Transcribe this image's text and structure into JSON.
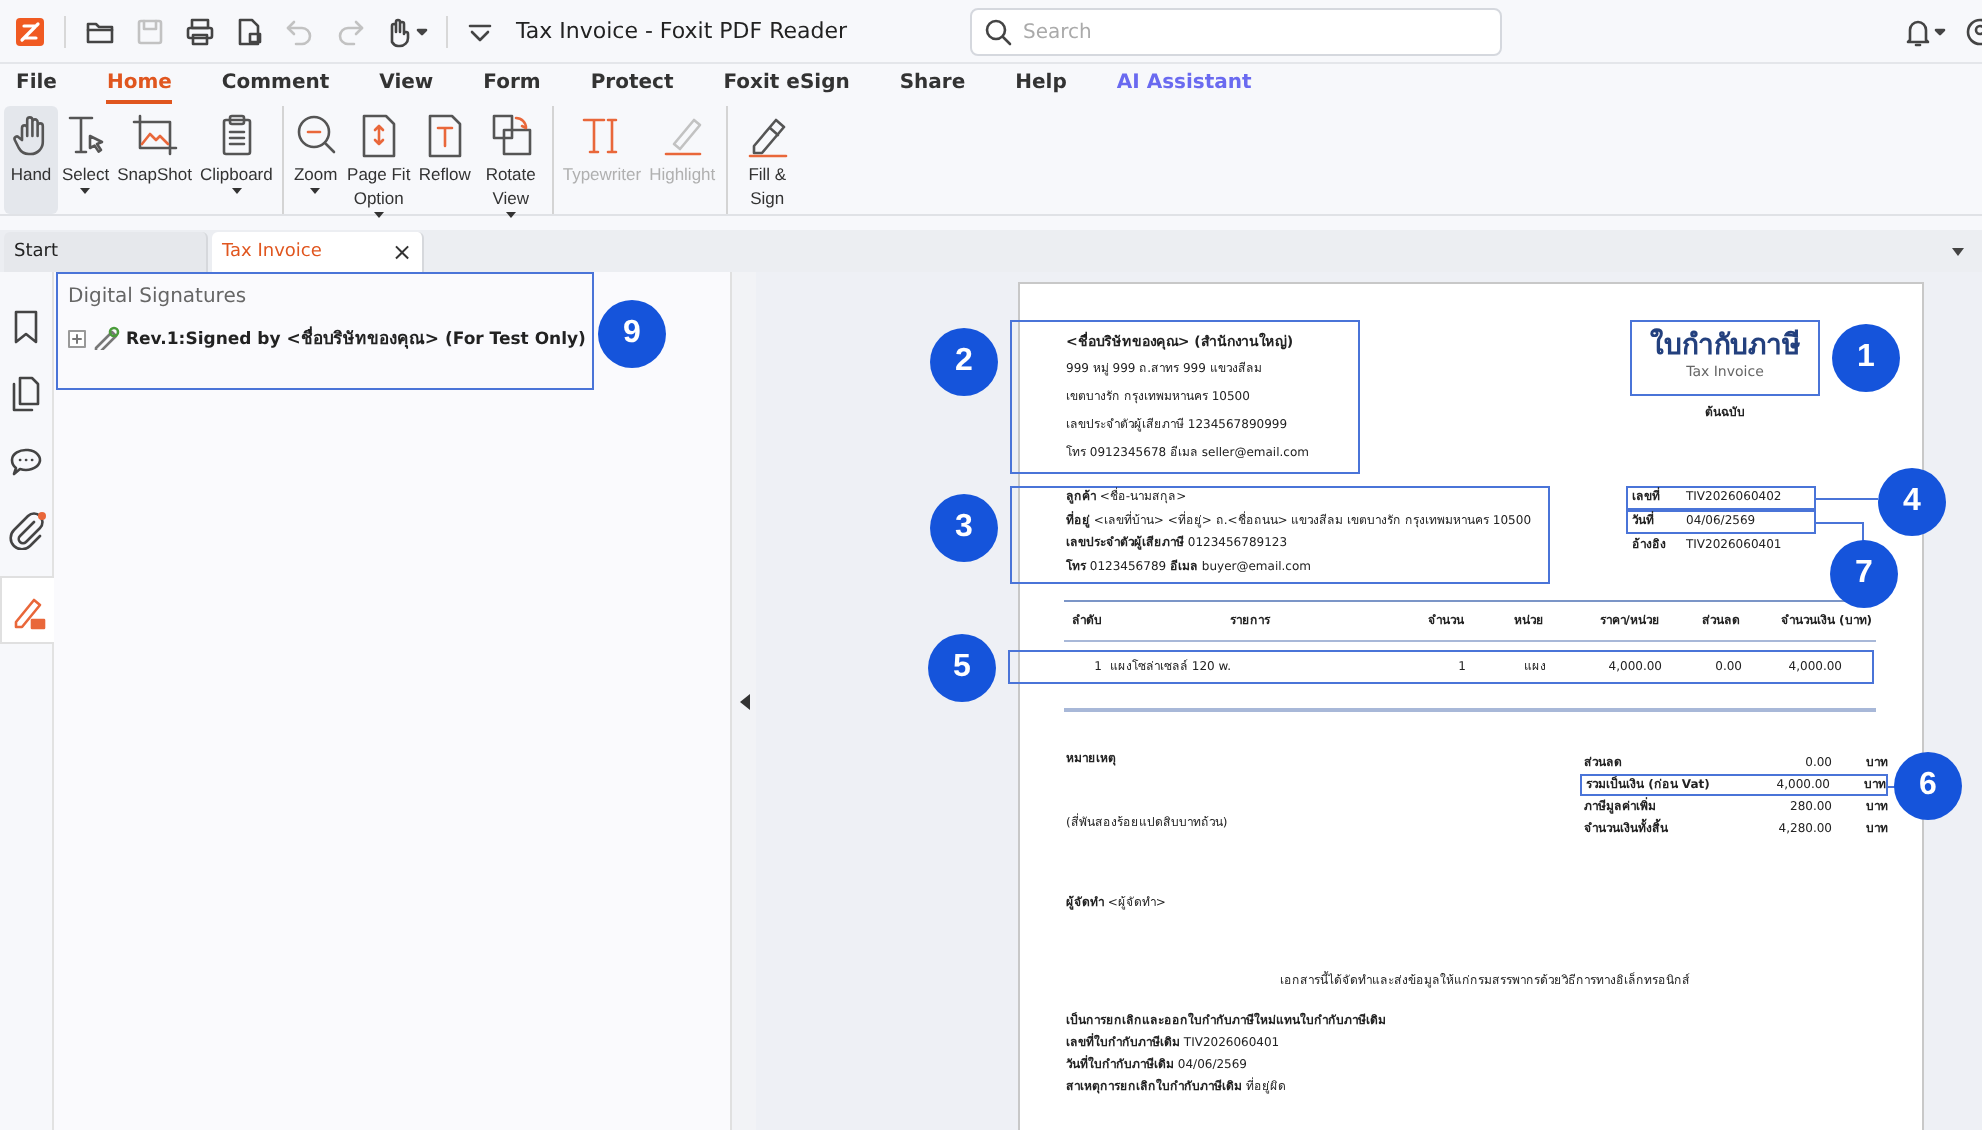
{
  "window": {
    "title": "Tax Invoice - Foxit PDF Reader"
  },
  "search": {
    "placeholder": "Search"
  },
  "menu": [
    {
      "label": "File",
      "selected": false,
      "kind": "menu"
    },
    {
      "label": "Home",
      "selected": true,
      "kind": "menu"
    },
    {
      "label": "Comment",
      "selected": false,
      "kind": "menu"
    },
    {
      "label": "View",
      "selected": false,
      "kind": "menu"
    },
    {
      "label": "Form",
      "selected": false,
      "kind": "menu"
    },
    {
      "label": "Protect",
      "selected": false,
      "kind": "menu"
    },
    {
      "label": "Foxit eSign",
      "selected": false,
      "kind": "menu"
    },
    {
      "label": "Share",
      "selected": false,
      "kind": "menu"
    },
    {
      "label": "Help",
      "selected": false,
      "kind": "menu"
    },
    {
      "label": "AI Assistant",
      "selected": false,
      "kind": "ai"
    }
  ],
  "ribbon": [
    {
      "label": "Hand",
      "selected": true,
      "disabled": false,
      "dropdown": false,
      "group_start": false
    },
    {
      "label": "Select",
      "selected": false,
      "disabled": false,
      "dropdown": true,
      "group_start": false
    },
    {
      "label": "SnapShot",
      "selected": false,
      "disabled": false,
      "dropdown": false,
      "group_start": false
    },
    {
      "label": "Clipboard",
      "selected": false,
      "disabled": false,
      "dropdown": true,
      "group_start": false
    },
    {
      "label": "Zoom",
      "selected": false,
      "disabled": false,
      "dropdown": true,
      "group_start": true
    },
    {
      "label": "Page Fit Option",
      "selected": false,
      "disabled": false,
      "dropdown": true,
      "group_start": false
    },
    {
      "label": "Reflow",
      "selected": false,
      "disabled": false,
      "dropdown": false,
      "group_start": false
    },
    {
      "label": "Rotate View",
      "selected": false,
      "disabled": false,
      "dropdown": true,
      "group_start": false
    },
    {
      "label": "Typewriter",
      "selected": false,
      "disabled": true,
      "dropdown": false,
      "group_start": true
    },
    {
      "label": "Highlight",
      "selected": false,
      "disabled": true,
      "dropdown": false,
      "group_start": false
    },
    {
      "label": "Fill & Sign",
      "selected": false,
      "disabled": false,
      "dropdown": false,
      "group_start": true
    }
  ],
  "doc_tabs": [
    {
      "label": "Start",
      "selected": false
    },
    {
      "label": "Tax Invoice",
      "selected": true,
      "close": "×"
    }
  ],
  "side_rail": [
    {
      "selected": false,
      "badge": false
    },
    {
      "selected": false,
      "badge": false
    },
    {
      "selected": false,
      "badge": false
    },
    {
      "selected": false,
      "badge": true
    },
    {
      "selected": true,
      "badge": false
    }
  ],
  "signature_panel": {
    "title": "Digital Signatures",
    "callout": "9",
    "items": [
      {
        "label": "Rev.1:Signed by <ชื่อบริษัทของคุณ> (For Test Only)",
        "expanded": false
      }
    ]
  },
  "document": {
    "title": {
      "text": "ใบกำกับภาษี",
      "subtitle": "Tax Invoice",
      "callout": "1"
    },
    "copy_label": "ต้นฉบับ",
    "seller": {
      "callout": "2",
      "name": "<ชื่อบริษัทของคุณ> (สำนักงานใหญ่)",
      "lines": [
        "999 หมู่ 999 ถ.สาทร 999 แขวงสีลม",
        "เขตบางรัก กรุงเทพมหานคร 10500",
        "เลขประจำตัวผู้เสียภาษี 1234567890999",
        "โทร 0912345678  อีเมล seller@email.com"
      ]
    },
    "buyer": {
      "callout": "3",
      "lines": [
        "**ลูกค้า** <ชื่อ-นามสกุล>",
        "**ที่อยู่** <เลขที่บ้าน> <ที่อยู่> ถ.<ชื่อถนน> แขวงสีลม เขตบางรัก กรุงเทพมหานคร 10500",
        "**เลขประจำตัวผู้เสียภาษี** 0123456789123",
        "**โทร** 0123456789 **อีเมล** buyer@email.com"
      ]
    },
    "meta": [
      {
        "label": "เลขที่",
        "value": "TIV2026060402",
        "callout": "4"
      },
      {
        "label": "วันที่",
        "value": "04/06/2569",
        "callout": "7"
      },
      {
        "label": "อ้างอิง",
        "value": "TIV2026060401"
      }
    ],
    "items_table": {
      "columns": [
        "ลำดับ",
        "รายการ",
        "จำนวน",
        "หน่วย",
        "ราคา/หน่วย",
        "ส่วนลด",
        "จำนวนเงิน (บาท)"
      ],
      "rows": [
        {
          "callout": "5",
          "cells": [
            "1",
            "แผงโซล่าเซลล์ 120 w.",
            "1",
            "แผง",
            "4,000.00",
            "0.00",
            "4,000.00"
          ]
        }
      ]
    },
    "remarks_label": "หมายเหตุ",
    "amount_in_words": "(สี่พันสองร้อยแปดสิบบาทถ้วน)",
    "totals": [
      {
        "label": "ส่วนลด",
        "value": "0.00",
        "unit": "บาท"
      },
      {
        "label": "รวมเป็นเงิน (ก่อน Vat)",
        "value": "4,000.00",
        "unit": "บาท",
        "callout": "6"
      },
      {
        "label": "ภาษีมูลค่าเพิ่ม",
        "value": "280.00",
        "unit": "บาท"
      },
      {
        "label": "จำนวนเงินทั้งสิ้น",
        "value": "4,280.00",
        "unit": "บาท"
      }
    ],
    "preparer": "**ผู้จัดทำ** <ผู้จัดทำ>",
    "e_tax_note": "เอกสารนี้ได้จัดทำและส่งข้อมูลให้แก่กรมสรรพากรด้วยวิธีการทางอิเล็กทรอนิกส์",
    "cancellation": {
      "heading": "เป็นการยกเลิกและออกใบกำกับภาษีใหม่แทนใบกำกับภาษีเดิม",
      "lines": [
        "**เลขที่ใบกำกับภาษีเดิม** TIV2026060401",
        "**วันที่ใบกำกับภาษีเดิม** 04/06/2569",
        "**สาเหตุการยกเลิกใบกำกับภาษีเดิม** ที่อยู่ผิด"
      ]
    }
  }
}
